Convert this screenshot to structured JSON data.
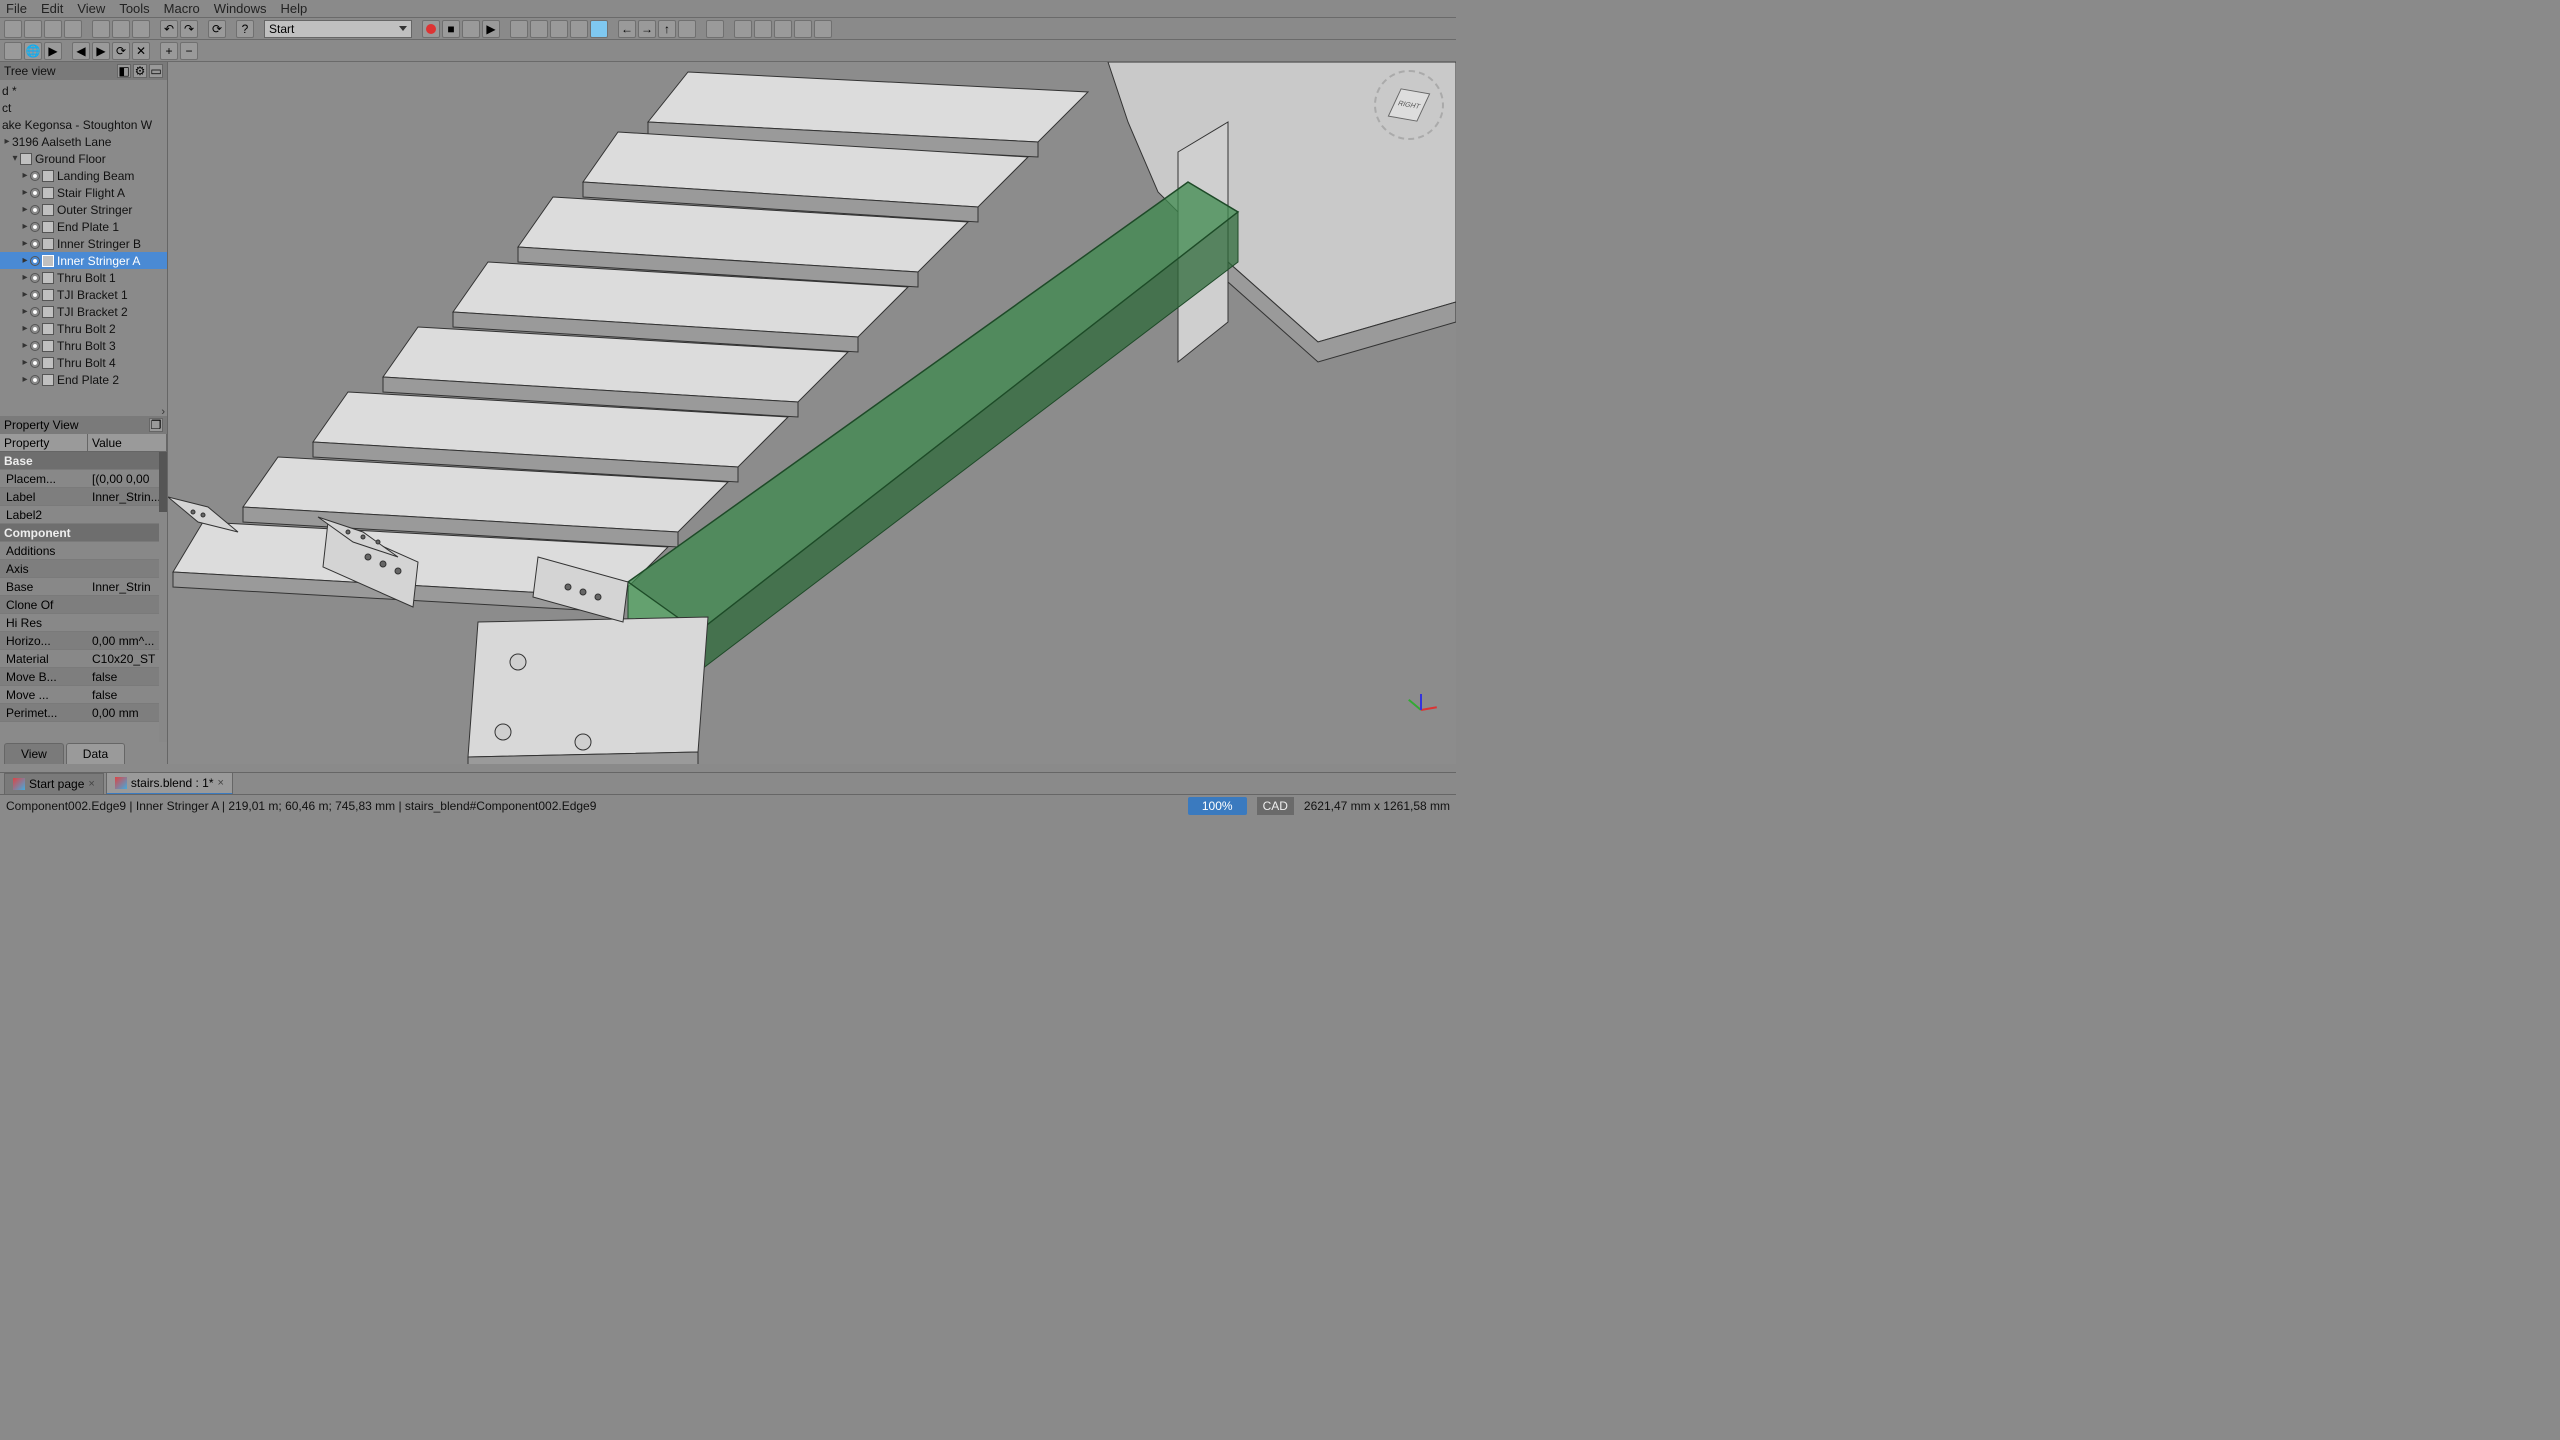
{
  "menu": {
    "items": [
      "File",
      "Edit",
      "View",
      "Tools",
      "Macro",
      "Windows",
      "Help"
    ]
  },
  "workbench": {
    "selected": "Start"
  },
  "tree_view": {
    "title": "Tree view",
    "root": "d *",
    "doc": "ct",
    "site": "ake Kegonsa - Stoughton W",
    "address": "3196 Aalseth Lane",
    "group": "Ground Floor",
    "items": [
      {
        "label": "Landing Beam",
        "sel": false
      },
      {
        "label": "Stair Flight A",
        "sel": false
      },
      {
        "label": "Outer Stringer",
        "sel": false
      },
      {
        "label": "End Plate 1",
        "sel": false
      },
      {
        "label": "Inner Stringer B",
        "sel": false
      },
      {
        "label": "Inner Stringer A",
        "sel": true
      },
      {
        "label": "Thru Bolt 1",
        "sel": false
      },
      {
        "label": "TJI Bracket 1",
        "sel": false
      },
      {
        "label": "TJI Bracket 2",
        "sel": false
      },
      {
        "label": "Thru Bolt 2",
        "sel": false
      },
      {
        "label": "Thru Bolt 3",
        "sel": false
      },
      {
        "label": "Thru Bolt 4",
        "sel": false
      },
      {
        "label": "End Plate 2",
        "sel": false
      }
    ]
  },
  "property_view": {
    "title": "Property View",
    "col_prop": "Property",
    "col_val": "Value",
    "groups": [
      {
        "header": "Base",
        "rows": [
          {
            "k": "Placem...",
            "v": "[(0,00 0,00"
          },
          {
            "k": "Label",
            "v": "Inner_Strin..."
          },
          {
            "k": "Label2",
            "v": ""
          }
        ]
      },
      {
        "header": "Component",
        "rows": [
          {
            "k": "Additions",
            "v": ""
          },
          {
            "k": "Axis",
            "v": ""
          },
          {
            "k": "Base",
            "v": "Inner_Strin"
          },
          {
            "k": "Clone Of",
            "v": ""
          },
          {
            "k": "Hi Res",
            "v": ""
          },
          {
            "k": "Horizo...",
            "v": "0,00 mm^..."
          },
          {
            "k": "Material",
            "v": "C10x20_ST"
          },
          {
            "k": "Move B...",
            "v": "false"
          },
          {
            "k": "Move ...",
            "v": "false"
          },
          {
            "k": "Perimet...",
            "v": "0,00 mm"
          }
        ]
      }
    ],
    "tabs": {
      "view": "View",
      "data": "Data"
    }
  },
  "doc_tabs": [
    {
      "label": "Start page",
      "active": false
    },
    {
      "label": "stairs.blend : 1*",
      "active": true
    }
  ],
  "status": {
    "left": "Component002.Edge9 | Inner Stringer A | 219,01 m; 60,46 m; 745,83 mm | stairs_blend#Component002.Edge9",
    "zoom": "100%",
    "mode": "CAD",
    "dims": "2621,47 mm x 1261,58 mm"
  },
  "nav_cube_face": "RIGHT"
}
